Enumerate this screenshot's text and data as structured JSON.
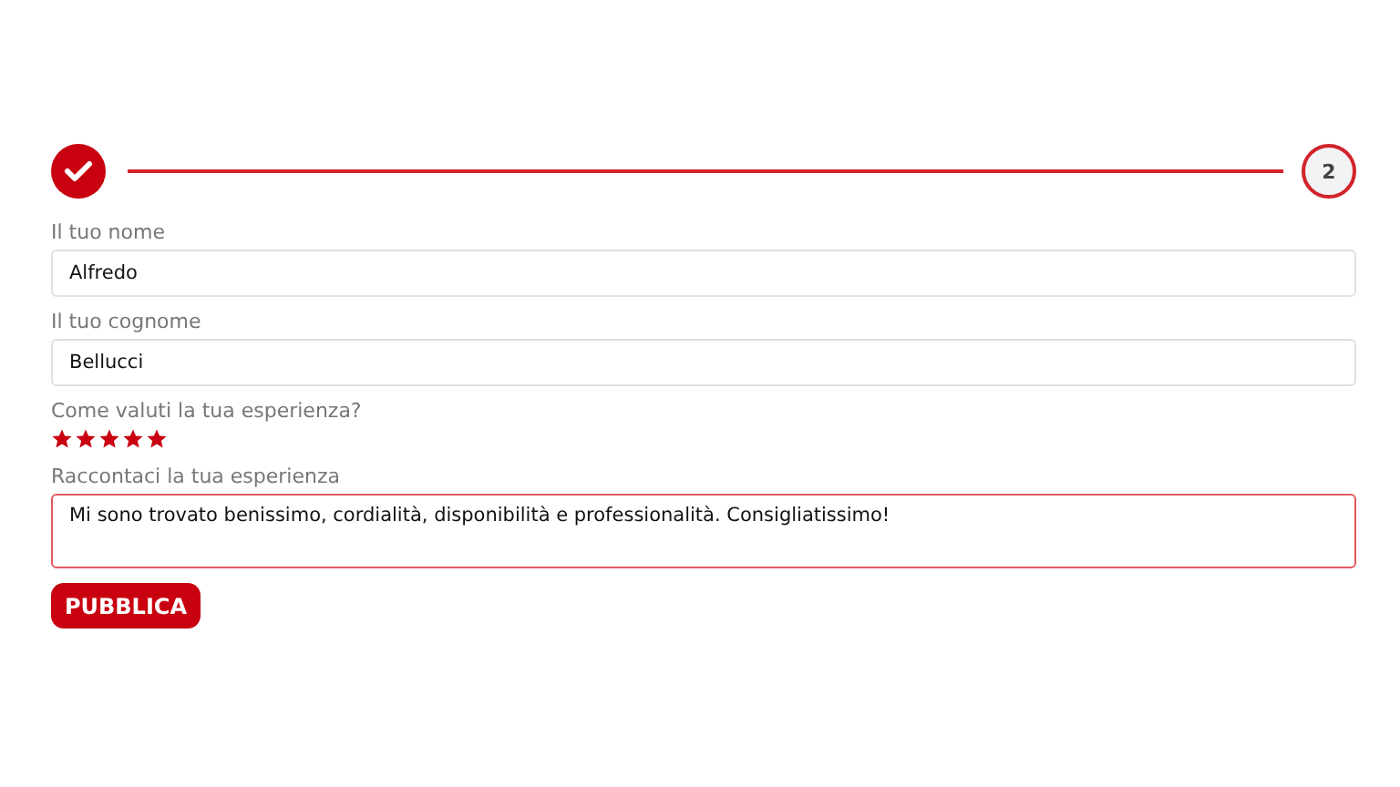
{
  "stepper": {
    "steps": [
      {
        "completed": true
      },
      {
        "completed": false,
        "label": "2"
      }
    ]
  },
  "form": {
    "fields": [
      {
        "kind": "input",
        "label": "Il tuo nome",
        "value": "Alfredo",
        "focused": false
      },
      {
        "kind": "input",
        "label": "Il tuo cognome",
        "value": "Bellucci",
        "focused": false
      },
      {
        "kind": "rating",
        "label": "Come valuti la tua esperienza?",
        "stars": 5
      },
      {
        "kind": "textarea",
        "label": "Raccontaci la tua esperienza",
        "value": "Mi sono trovato benissimo, cordialità, disponibilità e professionalità. Consigliatissimo!",
        "focused": true
      }
    ]
  },
  "submit_button": "PUBBLICA"
}
